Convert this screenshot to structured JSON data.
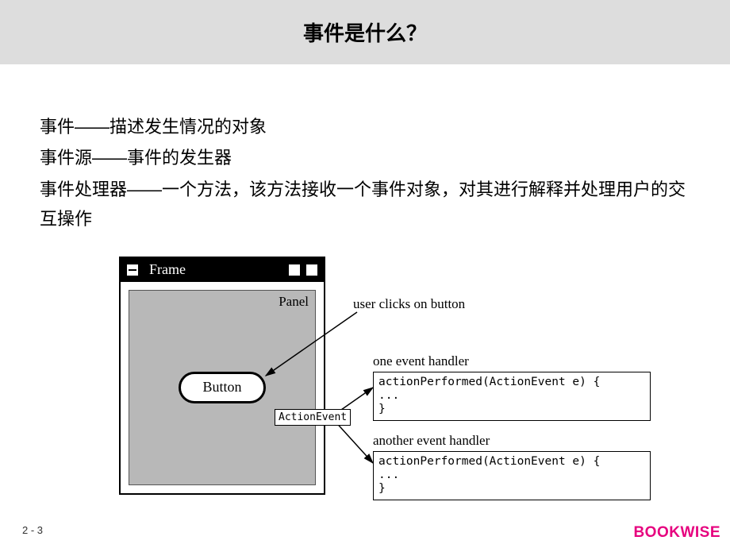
{
  "title": "事件是什么？",
  "bullets": {
    "b1": "事件——描述发生情况的对象",
    "b2": "事件源——事件的发生器",
    "b3": "事件处理器——一个方法，该方法接收一个事件对象，对其进行解释并处理用户的交互操作"
  },
  "diagram": {
    "frame_label": "Frame",
    "panel_label": "Panel",
    "button_label": "Button",
    "action_event_label": "ActionEvent",
    "user_clicks_label": "user clicks on button",
    "handler1_label": "one event handler",
    "handler2_label": "another event handler",
    "code_line1": "actionPerformed(ActionEvent e) {",
    "code_line2": "   ...",
    "code_line3": "}"
  },
  "page_number": "2 - 3",
  "brand": "BOOKWISE"
}
